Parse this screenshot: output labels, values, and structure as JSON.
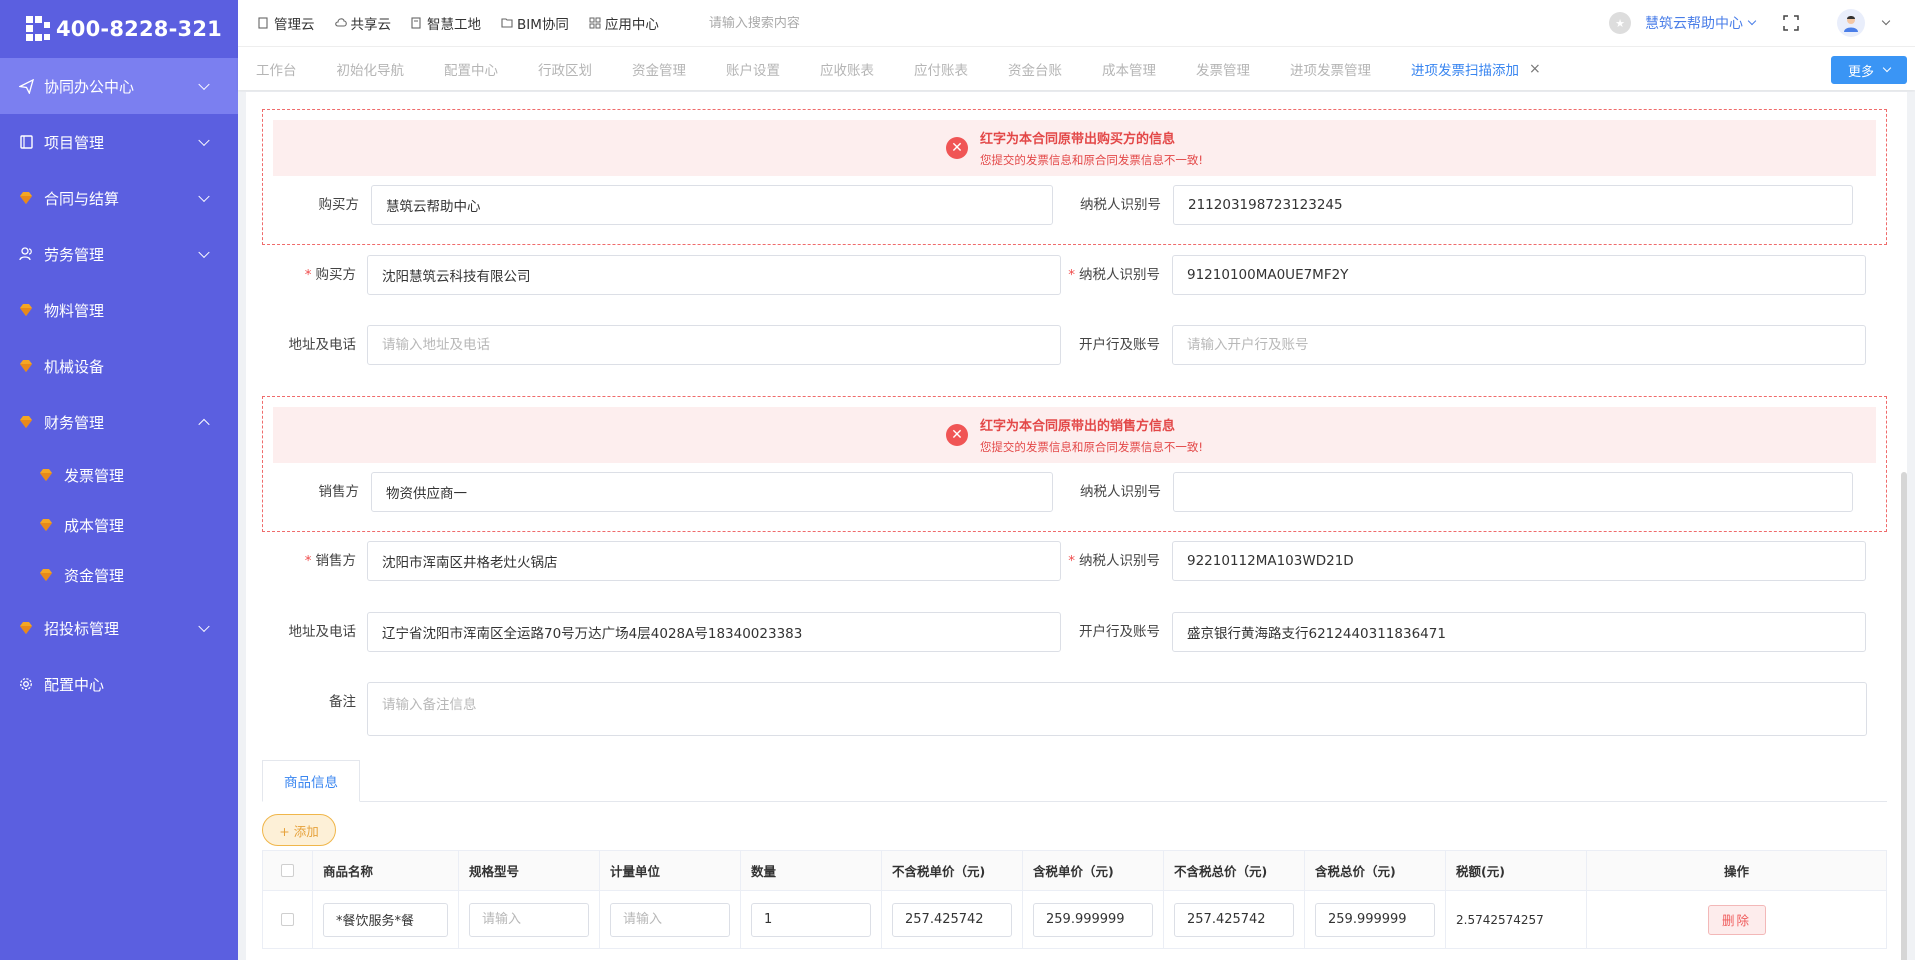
{
  "brand": {
    "phone": "400-8228-321"
  },
  "sidebar": {
    "items": [
      {
        "label": "协同办公中心",
        "icon": "paper-plane-icon"
      },
      {
        "label": "项目管理",
        "icon": "book-icon"
      },
      {
        "label": "合同与结算",
        "icon": "gem-icon"
      },
      {
        "label": "劳务管理",
        "icon": "user-group-icon"
      },
      {
        "label": "物料管理",
        "icon": "gem-icon"
      },
      {
        "label": "机械设备",
        "icon": "gem-icon"
      },
      {
        "label": "财务管理",
        "icon": "gem-icon"
      }
    ],
    "finance_sub": [
      {
        "label": "发票管理"
      },
      {
        "label": "成本管理"
      },
      {
        "label": "资金管理"
      }
    ],
    "bottom_items": [
      {
        "label": "招投标管理",
        "icon": "gem-icon"
      },
      {
        "label": "配置中心",
        "icon": "gear-icon"
      }
    ]
  },
  "topnav": {
    "items": [
      "管理云",
      "共享云",
      "智慧工地",
      "BIM协同",
      "应用中心"
    ],
    "search_placeholder": "请输入搜索内容",
    "help_center": "慧筑云帮助中心"
  },
  "tabs": {
    "items": [
      "工作台",
      "初始化导航",
      "配置中心",
      "行政区划",
      "资金管理",
      "账户设置",
      "应收账表",
      "应付账表",
      "资金台账",
      "成本管理",
      "发票管理",
      "进项发票管理"
    ],
    "active": "进项发票扫描添加",
    "close": "×",
    "more": "更多"
  },
  "buyer_warning": {
    "title": "红字为本合同原带出购买方的信息",
    "subtitle": "您提交的发票信息和原合同发票信息不一致!",
    "buyer_label": "购买方",
    "buyer_value": "慧筑云帮助中心",
    "tax_label": "纳税人识别号",
    "tax_value": "211203198723123245"
  },
  "buyer": {
    "req": "*",
    "buyer_label": "购买方",
    "buyer_value": "沈阳慧筑云科技有限公司",
    "tax_label": "纳税人识别号",
    "tax_value": "91210100MA0UE7MF2Y",
    "addr_label": "地址及电话",
    "addr_placeholder": "请输入地址及电话",
    "bank_label": "开户行及账号",
    "bank_placeholder": "请输入开户行及账号"
  },
  "seller_warning": {
    "title": "红字为本合同原带出的销售方信息",
    "subtitle": "您提交的发票信息和原合同发票信息不一致!",
    "seller_label": "销售方",
    "seller_value": "物资供应商一",
    "tax_label": "纳税人识别号",
    "tax_value": ""
  },
  "seller": {
    "req": "*",
    "seller_label": "销售方",
    "seller_value": "沈阳市浑南区井格老灶火锅店",
    "tax_label": "纳税人识别号",
    "tax_value": "92210112MA103WD21D",
    "addr_label": "地址及电话",
    "addr_value": "辽宁省沈阳市浑南区全运路70号万达广场4层4028A号18340023383",
    "bank_label": "开户行及账号",
    "bank_value": "盛京银行黄海路支行6212440311836471",
    "remark_label": "备注",
    "remark_placeholder": "请输入备注信息"
  },
  "goods": {
    "tab_label": "商品信息",
    "add_label": "+ 添加",
    "columns": [
      "商品名称",
      "规格型号",
      "计量单位",
      "数量",
      "不含税单价（元)",
      "含税单价（元)",
      "不含税总价（元)",
      "含税总价（元)",
      "税额(元)",
      "操作"
    ],
    "rows": [
      {
        "name": "*餐饮服务*餐",
        "spec_placeholder": "请输入",
        "unit_placeholder": "请输入",
        "qty": "1",
        "unit_price_ex": "257.425742",
        "unit_price_in": "259.999999",
        "total_ex": "257.425742",
        "total_in": "259.999999",
        "tax": "2.5742574257",
        "delete": "删除"
      }
    ]
  },
  "colors": {
    "sidebar_bg": "#5b5fe0",
    "sidebar_active": "#7b7ff0",
    "accent_blue": "#3a86f0",
    "warning_red": "#e34848",
    "add_orange": "#e6a23c"
  }
}
